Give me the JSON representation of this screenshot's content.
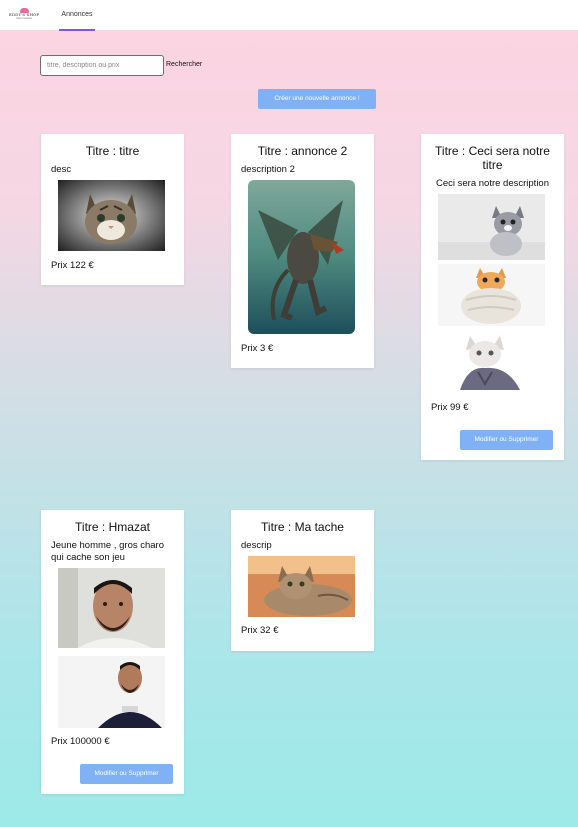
{
  "nav": {
    "logo_text": "EDDY'S SHOP",
    "logo_sub": "Votre boutique",
    "tab_label": "Annonces"
  },
  "search": {
    "placeholder": "titre, description ou prix",
    "button_label": "Rechercher"
  },
  "create_button_label": "Créer une nouvelle annonce !",
  "cards": [
    {
      "title": "Titre : titre",
      "description": "desc",
      "price": "Prix 122 €"
    },
    {
      "title": "Titre : annonce 2",
      "description": "description 2",
      "price": "Prix 3 €"
    },
    {
      "title": "Titre : Ceci sera notre titre",
      "description": "Ceci sera notre description",
      "price": "Prix 99 €",
      "button_label": "Modifier ou Supprimer"
    },
    {
      "title": "Titre : Hmazat",
      "description": "Jeune homme , gros charo qui cache son jeu",
      "price": "Prix 100000 €",
      "button_label": "Modifier ou Supprimer"
    },
    {
      "title": "Titre : Ma tache",
      "description": "descrip",
      "price": "Prix 32 €"
    }
  ],
  "colors": {
    "accent": "#7fb1f4",
    "tab_underline": "#7b5be0",
    "gradient_top": "#fdd3e2",
    "gradient_bottom": "#9deae8"
  }
}
